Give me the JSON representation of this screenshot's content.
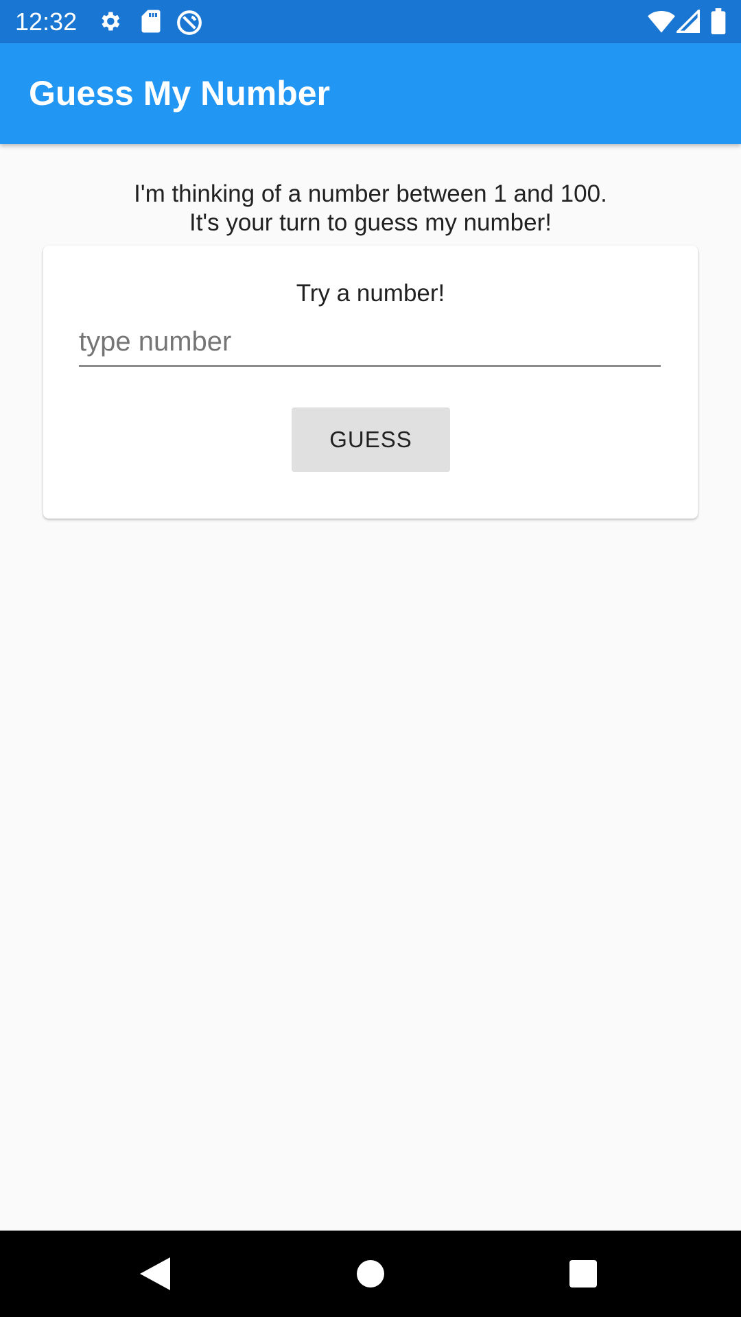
{
  "status_bar": {
    "time": "12:32",
    "left_icons": [
      "settings-icon",
      "sd-card-icon",
      "no-disturb-icon"
    ],
    "right_icons": [
      "wifi-icon",
      "signal-icon",
      "battery-icon"
    ],
    "background": "#1976d2"
  },
  "app_bar": {
    "title": "Guess My Number",
    "background": "#2196f3"
  },
  "intro": {
    "line1": "I'm thinking of a number between 1 and 100.",
    "line2": "It's your turn to guess my number!"
  },
  "card": {
    "title": "Try a number!",
    "input": {
      "value": "",
      "placeholder": "type number"
    },
    "guess_label": "GUESS"
  },
  "nav_bar": {
    "buttons": [
      "back-icon",
      "home-icon",
      "recents-icon"
    ]
  }
}
